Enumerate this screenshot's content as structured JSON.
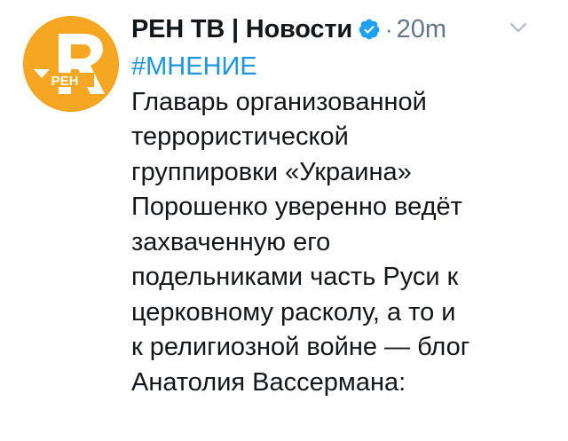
{
  "tweet": {
    "author": {
      "display_name": "РЕН ТВ | Новости",
      "verified": true,
      "avatar_text": "РЕН",
      "avatar_color": "#f5a623"
    },
    "separator": "·",
    "timestamp": "20m",
    "menu_icon": "chevron-down-icon",
    "hashtag": "#МНЕНИЕ",
    "hashtag_color": "#1b95e0",
    "text_lines": [
      "Главарь организованной",
      "террористической",
      "группировки «Украина»",
      "Порошенко уверенно ведёт",
      "захваченную его",
      "подельниками часть Руси к",
      "церковному расколу, а то и",
      "к религиозной войне — блог",
      "Анатолия Вассермана:"
    ]
  }
}
